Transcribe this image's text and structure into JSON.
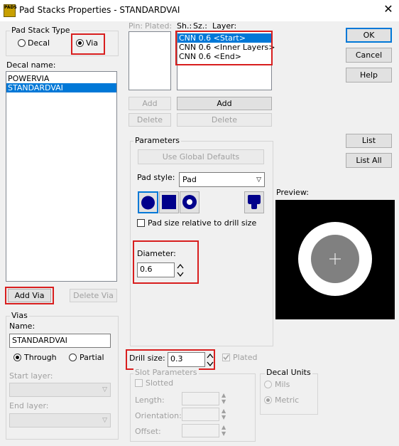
{
  "window": {
    "title": "Pad Stacks Properties - STANDARDVAI",
    "app_icon_text": "PADS"
  },
  "pad_stack_type": {
    "label": "Pad Stack Type",
    "decal": "Decal",
    "via": "Via"
  },
  "decal_list": {
    "label": "Decal name:",
    "items": [
      "POWERVIA",
      "STANDARDVAI"
    ],
    "selected": "STANDARDVAI"
  },
  "left_buttons": {
    "add_via": "Add Via",
    "delete_via": "Delete Via"
  },
  "vias": {
    "label": "Vias",
    "name_label": "Name:",
    "name_value": "STANDARDVAI",
    "through": "Through",
    "partial": "Partial",
    "start_layer": "Start layer:",
    "end_layer": "End layer:"
  },
  "pins": {
    "header_pin": "Pin:",
    "header_plated": "Plated:",
    "add": "Add",
    "delete": "Delete"
  },
  "layers": {
    "header_sh": "Sh.:",
    "header_sz": "Sz.:",
    "header_layer": "Layer:",
    "items": [
      "CNN 0.6 <Start>",
      "CNN 0.6 <Inner Layers>",
      "CNN 0.6 <End>"
    ],
    "add": "Add",
    "delete": "Delete"
  },
  "parameters": {
    "label": "Parameters",
    "use_global": "Use Global Defaults",
    "pad_style_label": "Pad style:",
    "pad_style_value": "Pad",
    "shape_icons": [
      "round-pad-icon",
      "square-pad-icon",
      "annular-pad-icon",
      "odd-shape-pad-icon"
    ],
    "relative_checkbox": "Pad size relative to drill size",
    "diameter_label": "Diameter:",
    "diameter_value": "0.6"
  },
  "drill": {
    "label": "Drill size:",
    "value": "0.3",
    "plated": "Plated"
  },
  "slot": {
    "label": "Slot Parameters",
    "slotted": "Slotted",
    "length": "Length:",
    "orientation": "Orientation:",
    "offset": "Offset:"
  },
  "decal_units": {
    "label": "Decal Units",
    "mils": "Mils",
    "metric": "Metric"
  },
  "right_buttons": {
    "ok": "OK",
    "cancel": "Cancel",
    "help": "Help",
    "list": "List",
    "list_all": "List All"
  },
  "preview": {
    "label": "Preview:"
  },
  "colors": {
    "accent": "#0078d7",
    "highlight": "#d81e1e",
    "pad_icon": "#00008b",
    "preview_bg": "#000000"
  }
}
